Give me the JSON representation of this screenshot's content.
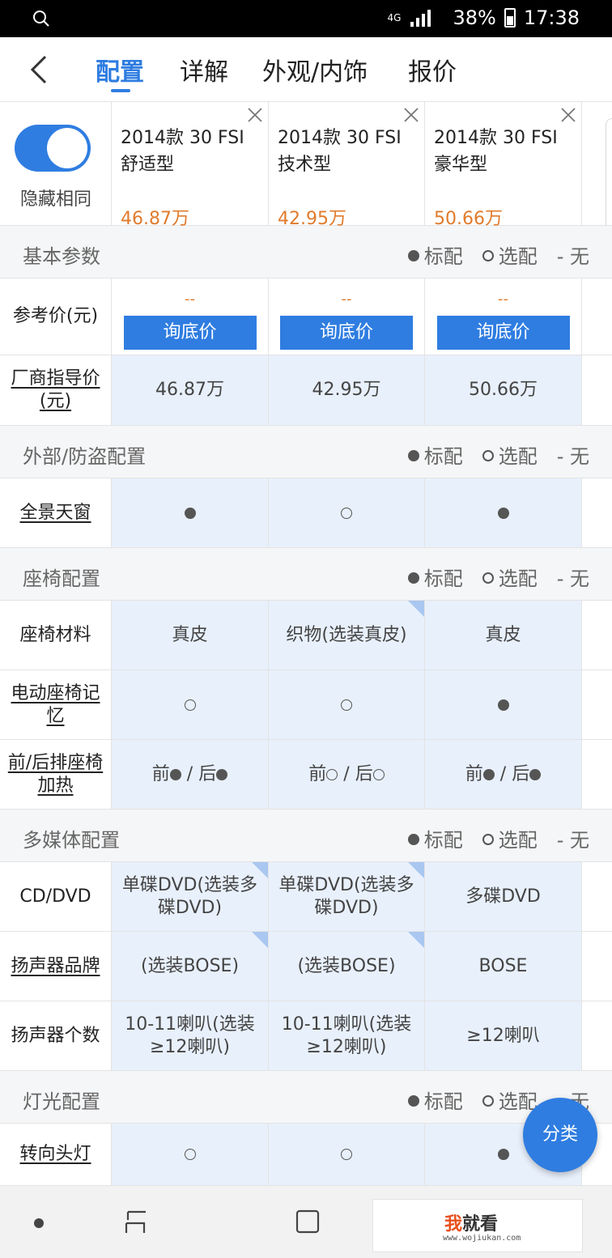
{
  "status_bar": {
    "network": "4G",
    "battery": "38%",
    "time": "17:38"
  },
  "nav": {
    "tabs": [
      {
        "label": "配置"
      },
      {
        "label": "详解"
      },
      {
        "label": "外观/内饰"
      },
      {
        "label": "报价"
      }
    ],
    "active_tab": "配置"
  },
  "compare": {
    "toggle_label": "隐藏相同",
    "toggle_on": true,
    "cars": [
      {
        "name": "2014款 30 FSI\n舒适型",
        "price": "46.87万"
      },
      {
        "name": "2014款 30 FSI\n技术型",
        "price": "42.95万"
      },
      {
        "name": "2014款 30 FSI\n豪华型",
        "price": "50.66万"
      }
    ]
  },
  "legend": {
    "standard": "标配",
    "optional": "选配",
    "none": "- 无"
  },
  "sections": {
    "basic": "基本参数",
    "exterior": "外部/防盗配置",
    "seat": "座椅配置",
    "media": "多媒体配置",
    "light": "灯光配置"
  },
  "rows": {
    "ref_price": {
      "label": "参考价(元)",
      "dash": "--",
      "button": "询底价"
    },
    "msrp": {
      "label": "厂商指导价(元)",
      "values": [
        "46.87万",
        "42.95万",
        "50.66万"
      ]
    },
    "sunroof": {
      "label": "全景天窗"
    },
    "seat_material": {
      "label": "座椅材料",
      "values": [
        "真皮",
        "织物(选装真皮)",
        "真皮"
      ]
    },
    "seat_memory": {
      "label": "电动座椅记忆"
    },
    "seat_heating": {
      "label": "前/后排座椅加热",
      "front": "前",
      "sep": " / ",
      "rear": "后"
    },
    "cd_dvd": {
      "label": "CD/DVD",
      "values": [
        "单碟DVD(选装多碟DVD)",
        "单碟DVD(选装多碟DVD)",
        "多碟DVD"
      ]
    },
    "speaker_brand": {
      "label": "扬声器品牌",
      "values": [
        "(选装BOSE)",
        "(选装BOSE)",
        "BOSE"
      ]
    },
    "speaker_count": {
      "label": "扬声器个数",
      "values": [
        "10-11喇叭(选装≥12喇叭)",
        "10-11喇叭(选装≥12喇叭)",
        "≥12喇叭"
      ]
    },
    "turn_headlight": {
      "label": "转向头灯"
    }
  },
  "fab": {
    "label": "分类"
  },
  "watermark": {
    "text_a": "我",
    "text_b": "就看",
    "url": "www.wojiukan.com"
  },
  "colors": {
    "accent": "#2f7de1",
    "price_orange": "#e07b2c",
    "cell_bg": "#e8f0fc",
    "section_bg": "#f5f6f7"
  }
}
